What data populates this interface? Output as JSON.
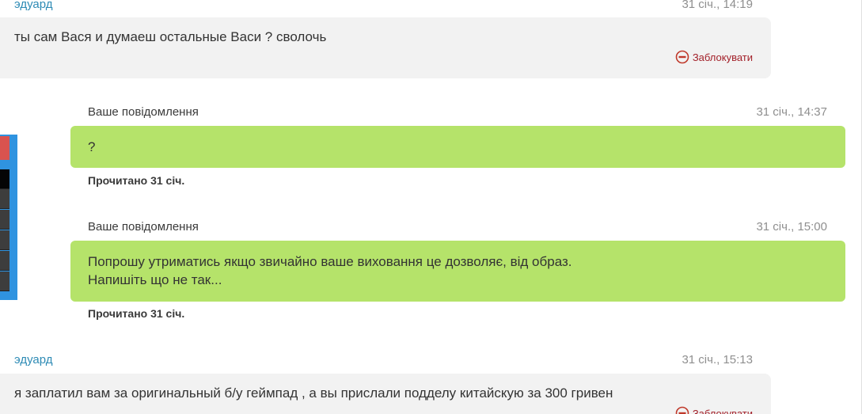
{
  "messages": [
    {
      "author": "эдуард",
      "time": "31 січ., 14:19",
      "text": "ты сам Вася и думаеш остальные Васи ? сволочь",
      "block_label": "Заблокувати"
    },
    {
      "author": "Ваше повідомлення",
      "time": "31 січ., 14:37",
      "text": "?",
      "status": "Прочитано 31 січ."
    },
    {
      "author": "Ваше повідомлення",
      "time": "31 січ., 15:00",
      "line1": "Попрошу утриматись якщо звичайно ваше виховання це дозволяє, від образ.",
      "line2": "Напишіть що не так...",
      "status": "Прочитано 31 січ."
    },
    {
      "author": "эдуард",
      "time": "31 січ., 15:13",
      "text": "я заплатил вам за оригинальный б/у геймпад , а вы прислали подделу китайскую за 300 гривен",
      "block_label": "Заблокувати"
    }
  ],
  "colors": {
    "incoming_bubble": "#f2f2f2",
    "outgoing_bubble": "#b5e36a",
    "author_link": "#2e8bb5",
    "block_red": "#a3212a"
  },
  "icons": {
    "block": "block-icon"
  }
}
